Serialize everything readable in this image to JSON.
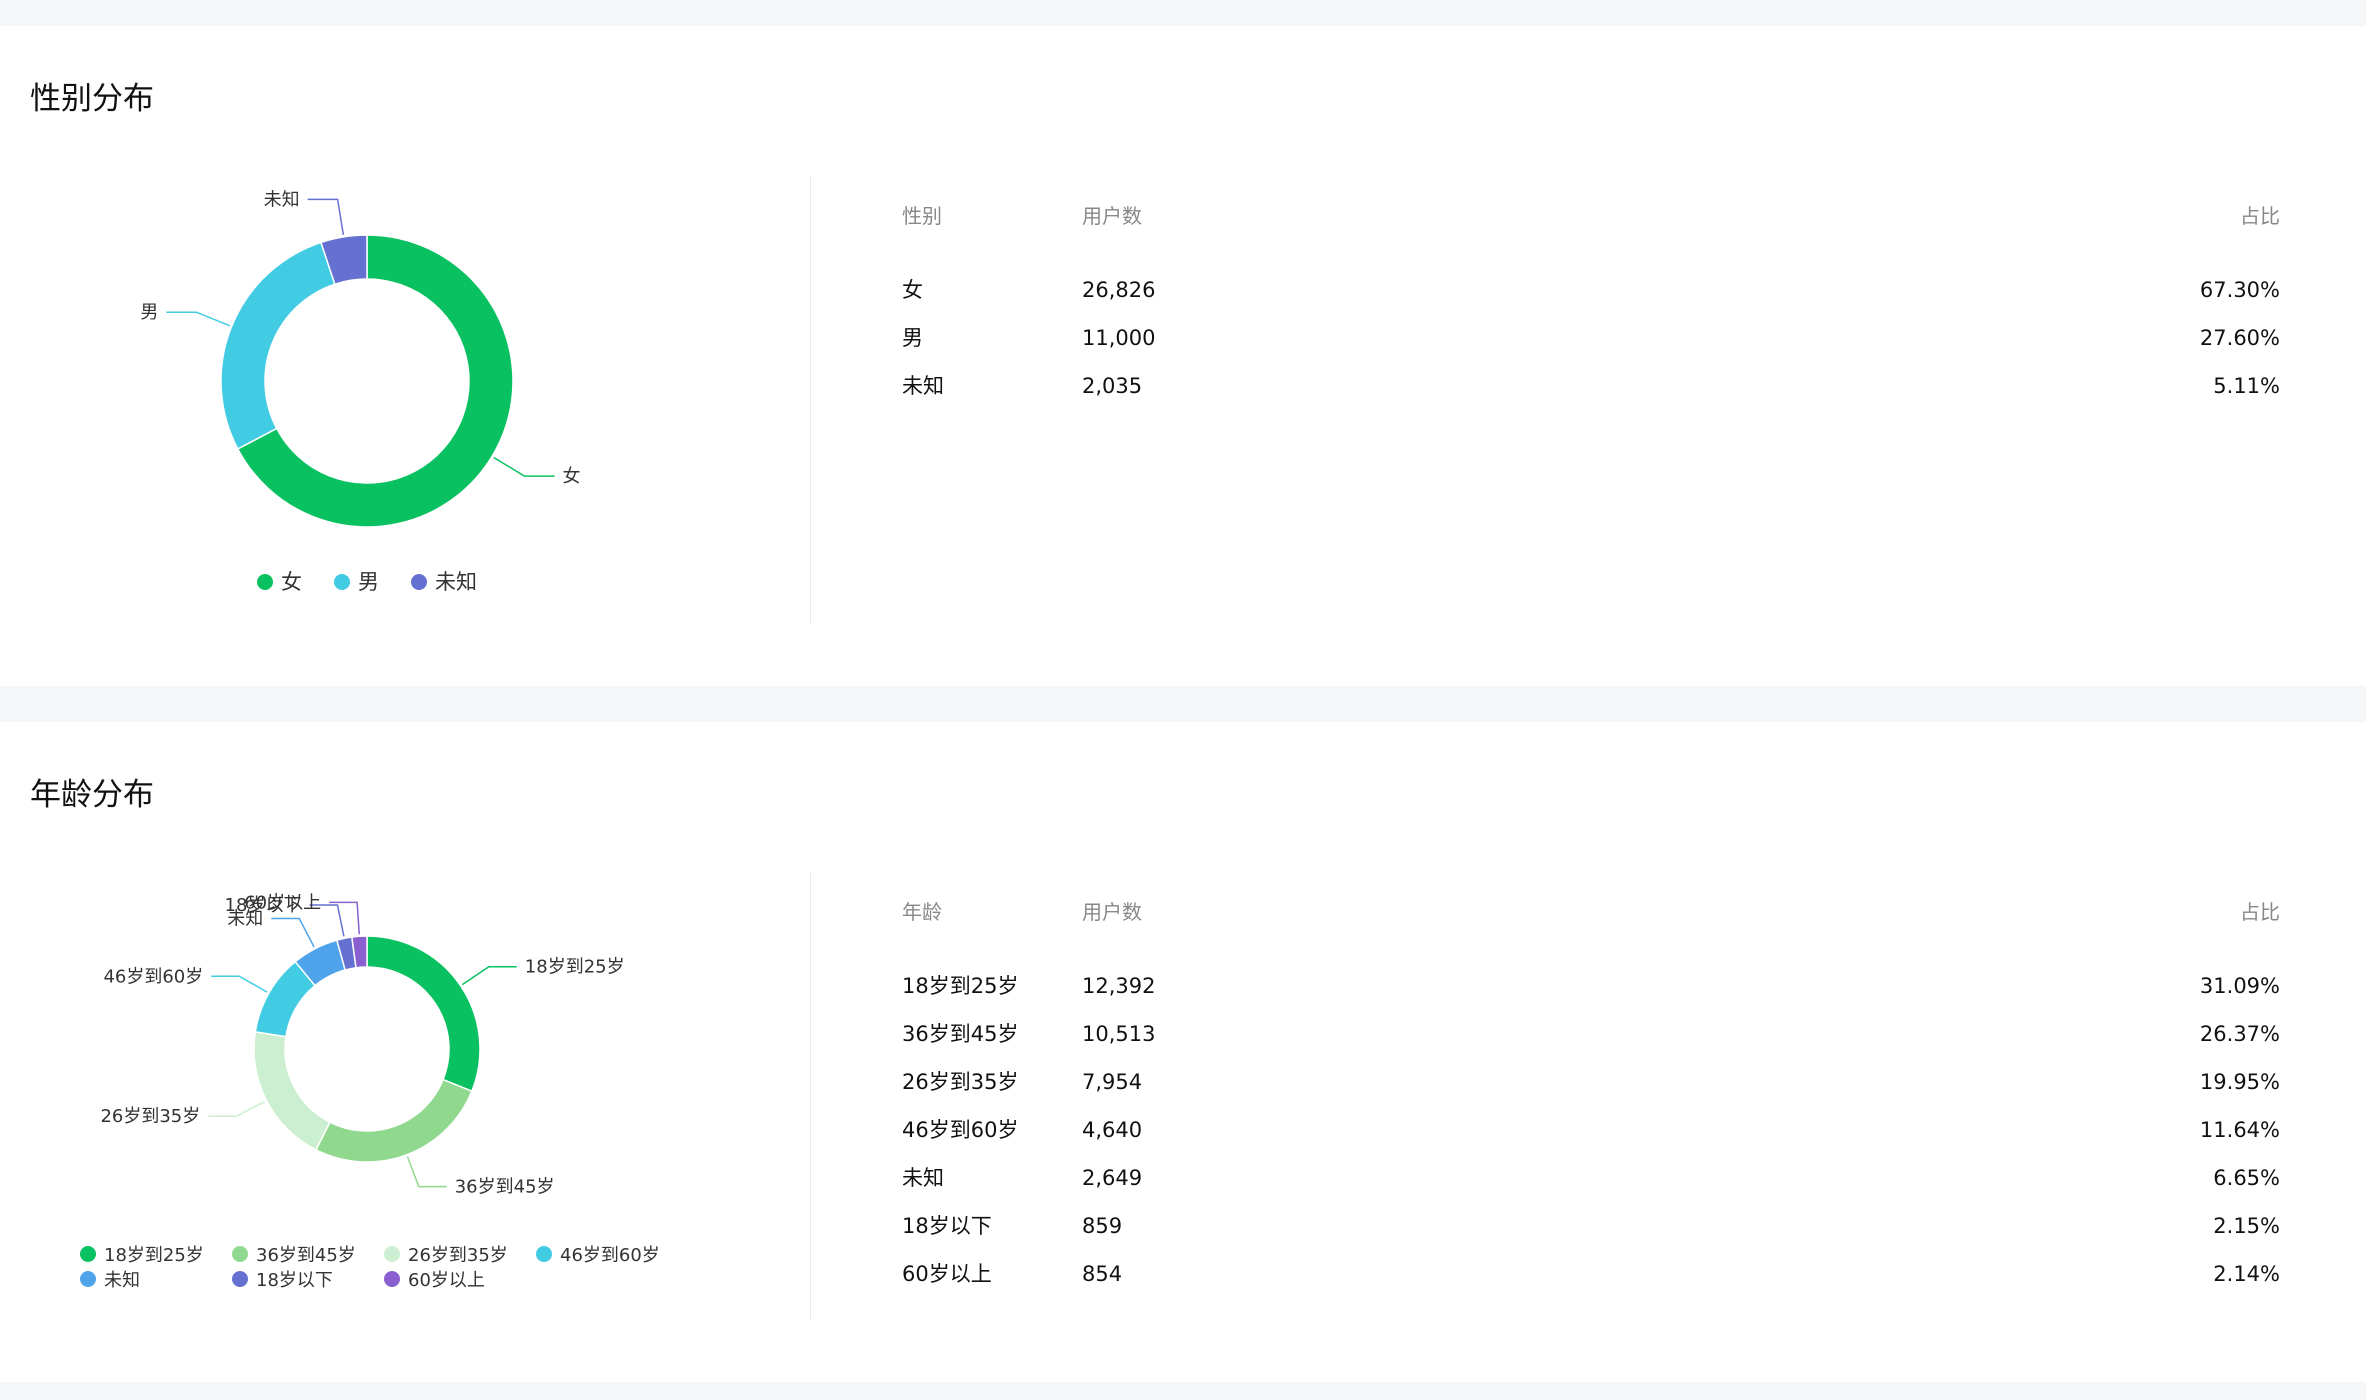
{
  "sections": {
    "gender": {
      "title": "性别分布",
      "table": {
        "headers": [
          "性别",
          "用户数",
          "占比"
        ],
        "rows": [
          [
            "女",
            "26,826",
            "67.30%"
          ],
          [
            "男",
            "11,000",
            "27.60%"
          ],
          [
            "未知",
            "2,035",
            "5.11%"
          ]
        ]
      }
    },
    "age": {
      "title": "年龄分布",
      "table": {
        "headers": [
          "年龄",
          "用户数",
          "占比"
        ],
        "rows": [
          [
            "18岁到25岁",
            "12,392",
            "31.09%"
          ],
          [
            "36岁到45岁",
            "10,513",
            "26.37%"
          ],
          [
            "26岁到35岁",
            "7,954",
            "19.95%"
          ],
          [
            "46岁到60岁",
            "4,640",
            "11.64%"
          ],
          [
            "未知",
            "2,649",
            "6.65%"
          ],
          [
            "18岁以下",
            "859",
            "2.15%"
          ],
          [
            "60岁以上",
            "854",
            "2.14%"
          ]
        ]
      }
    }
  },
  "chart_data": [
    {
      "type": "pie",
      "donut": true,
      "categories": [
        "女",
        "男",
        "未知"
      ],
      "values": [
        26826,
        11000,
        2035
      ],
      "colors": [
        "#09c160",
        "#41cce3",
        "#6471d0"
      ],
      "legend": "bottom"
    },
    {
      "type": "pie",
      "donut": true,
      "categories": [
        "18岁到25岁",
        "36岁到45岁",
        "26岁到35岁",
        "46岁到60岁",
        "未知",
        "18岁以下",
        "60岁以上"
      ],
      "values": [
        12392,
        10513,
        7954,
        4640,
        2649,
        859,
        854
      ],
      "colors": [
        "#09c160",
        "#91d88f",
        "#cdefd1",
        "#41cce3",
        "#4fa3ea",
        "#6471d0",
        "#8a60d0"
      ],
      "legend": "bottom"
    }
  ]
}
